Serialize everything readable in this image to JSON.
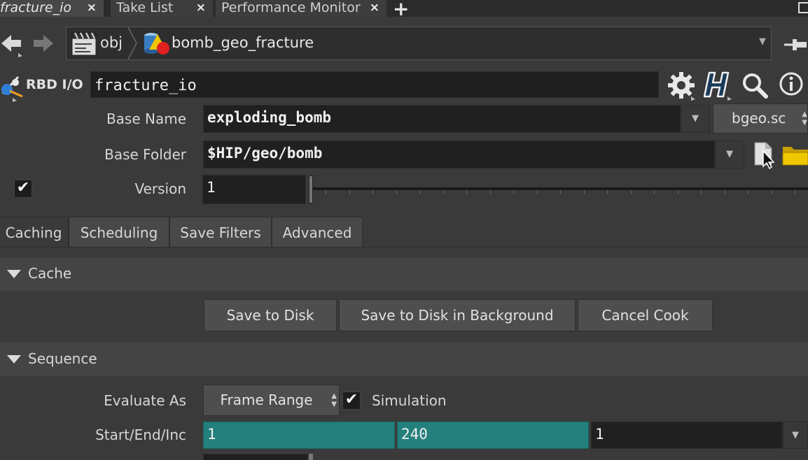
{
  "tabs": [
    {
      "label": "fracture_io",
      "close": "×",
      "active": true
    },
    {
      "label": "Take List",
      "close": "×",
      "active": false
    },
    {
      "label": "Performance Monitor",
      "close": "×",
      "active": false
    }
  ],
  "tab_add": "+",
  "path": {
    "root": "obj",
    "node": "bomb_geo_fracture",
    "dropdown": "▼"
  },
  "node": {
    "type_label": "RBD I/O",
    "name": "fracture_io"
  },
  "params": {
    "base_name": {
      "label": "Base Name",
      "value": "exploding_bomb",
      "format": "bgeo.sc"
    },
    "base_folder": {
      "label": "Base Folder",
      "value": "$HIP/geo/bomb"
    },
    "version": {
      "label": "Version",
      "value": "1",
      "enabled": true
    }
  },
  "folder_tabs": [
    "Caching",
    "Scheduling",
    "Save Filters",
    "Advanced"
  ],
  "sections": {
    "cache": {
      "title": "Cache",
      "buttons": [
        "Save to Disk",
        "Save to Disk in Background",
        "Cancel Cook"
      ]
    },
    "sequence": {
      "title": "Sequence",
      "evaluate_as": {
        "label": "Evaluate As",
        "value": "Frame Range"
      },
      "simulation": {
        "label": "Simulation",
        "checked": true
      },
      "start_end_inc": {
        "label": "Start/End/Inc",
        "start": "1",
        "end": "240",
        "inc": "1"
      }
    }
  },
  "colors": {
    "background": "#3a3a3a",
    "field": "#202020",
    "keyframe_teal": "#23807c"
  }
}
